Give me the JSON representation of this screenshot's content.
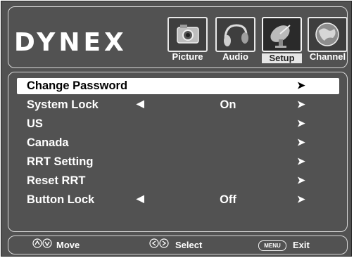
{
  "brand": {
    "logo_text": "DYNEX"
  },
  "tabs": [
    {
      "label": "Picture",
      "icon": "camera-icon",
      "active": false
    },
    {
      "label": "Audio",
      "icon": "headphones-icon",
      "active": false
    },
    {
      "label": "Setup",
      "icon": "satellite-dish-icon",
      "active": true
    },
    {
      "label": "Channel",
      "icon": "globe-icon",
      "active": false
    }
  ],
  "menu": {
    "items": [
      {
        "label": "Change Password",
        "left_arrow": "",
        "value": "",
        "right_arrow": "➤",
        "selected": true
      },
      {
        "label": "System Lock",
        "left_arrow": "◀",
        "value": "On",
        "right_arrow": "➤",
        "selected": false
      },
      {
        "label": "US",
        "left_arrow": "",
        "value": "",
        "right_arrow": "➤",
        "selected": false
      },
      {
        "label": "Canada",
        "left_arrow": "",
        "value": "",
        "right_arrow": "➤",
        "selected": false
      },
      {
        "label": "RRT Setting",
        "left_arrow": "",
        "value": "",
        "right_arrow": "➤",
        "selected": false
      },
      {
        "label": "Reset RRT",
        "left_arrow": "",
        "value": "",
        "right_arrow": "➤",
        "selected": false
      },
      {
        "label": "Button Lock",
        "left_arrow": "◀",
        "value": "Off",
        "right_arrow": "➤",
        "selected": false
      }
    ]
  },
  "footer": {
    "move_label": "Move",
    "select_label": "Select",
    "menu_key_label": "MENU",
    "exit_label": "Exit"
  },
  "colors": {
    "background": "#525252",
    "text": "#ffffff",
    "highlight": "#ffffff"
  }
}
